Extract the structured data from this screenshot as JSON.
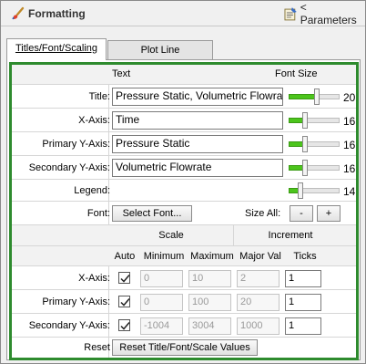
{
  "header": {
    "title": "Formatting",
    "params_label": "< Parameters"
  },
  "tabs": {
    "active": "Titles/Font/Scaling",
    "inactive": "Plot Line Style/Colors"
  },
  "columns": {
    "text": "Text",
    "font_size": "Font Size"
  },
  "titles": {
    "title": {
      "label": "Title:",
      "value": "Pressure Static, Volumetric Flowrate vs",
      "font_size": "20",
      "level": 0.55
    },
    "x_axis": {
      "label": "X-Axis:",
      "value": "Time",
      "font_size": "16",
      "level": 0.3
    },
    "primary_y": {
      "label": "Primary Y-Axis:",
      "value": "Pressure Static",
      "font_size": "16",
      "level": 0.3
    },
    "secondary_y": {
      "label": "Secondary Y-Axis:",
      "value": "Volumetric Flowrate",
      "font_size": "16",
      "level": 0.3
    },
    "legend": {
      "label": "Legend:",
      "font_size": "14",
      "level": 0.2
    }
  },
  "font": {
    "label": "Font:",
    "select_button": "Select Font...",
    "size_all_label": "Size All:",
    "minus": "-",
    "plus": "+"
  },
  "scale_headers": {
    "scale": "Scale",
    "increment": "Increment",
    "auto": "Auto",
    "minimum": "Minimum",
    "maximum": "Maximum",
    "major_val": "Major Val",
    "ticks": "Ticks"
  },
  "scales": {
    "x_axis": {
      "label": "X-Axis:",
      "auto": true,
      "minimum": "0",
      "maximum": "10",
      "major_val": "2",
      "ticks": "1"
    },
    "primary_y": {
      "label": "Primary Y-Axis:",
      "auto": true,
      "minimum": "0",
      "maximum": "100",
      "major_val": "20",
      "ticks": "1"
    },
    "secondary_y": {
      "label": "Secondary Y-Axis:",
      "auto": true,
      "minimum": "-1004",
      "maximum": "3004",
      "major_val": "1000",
      "ticks": "1"
    }
  },
  "reset": {
    "label": "Reset",
    "button": "Reset Title/Font/Scale Values"
  },
  "colors": {
    "border_green": "#2e8b2e",
    "slider_fill": "#4cc51c"
  }
}
